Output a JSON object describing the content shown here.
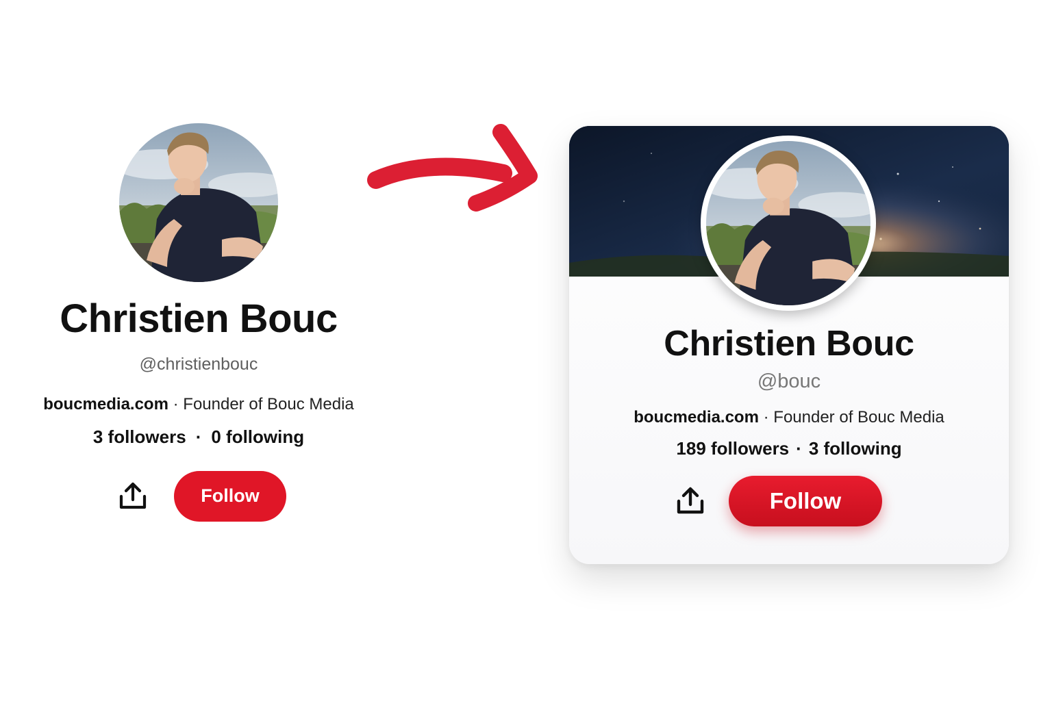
{
  "colors": {
    "accent": "#e01627",
    "arrow": "#dc1f33",
    "banner_dark": "#0f1c33",
    "text": "#111111",
    "muted": "#777777"
  },
  "before": {
    "avatar_icon": "profile-photo",
    "name": "Christien Bouc",
    "handle": "@christienbouc",
    "website": "boucmedia.com",
    "separator": "·",
    "tagline": "Founder of Bouc Media",
    "followers": "3 followers",
    "following": "0 following",
    "stats_separator": "·",
    "share_icon": "share-upload-icon",
    "follow_label": "Follow"
  },
  "arrow_icon": "curved-arrow-right",
  "after": {
    "avatar_icon": "profile-photo",
    "banner": "starry-night-banner",
    "name": "Christien Bouc",
    "handle": "@bouc",
    "website": "boucmedia.com",
    "separator": "·",
    "tagline": "Founder of Bouc Media",
    "followers": "189 followers",
    "following": "3 following",
    "stats_separator": "·",
    "share_icon": "share-upload-icon",
    "follow_label": "Follow"
  }
}
